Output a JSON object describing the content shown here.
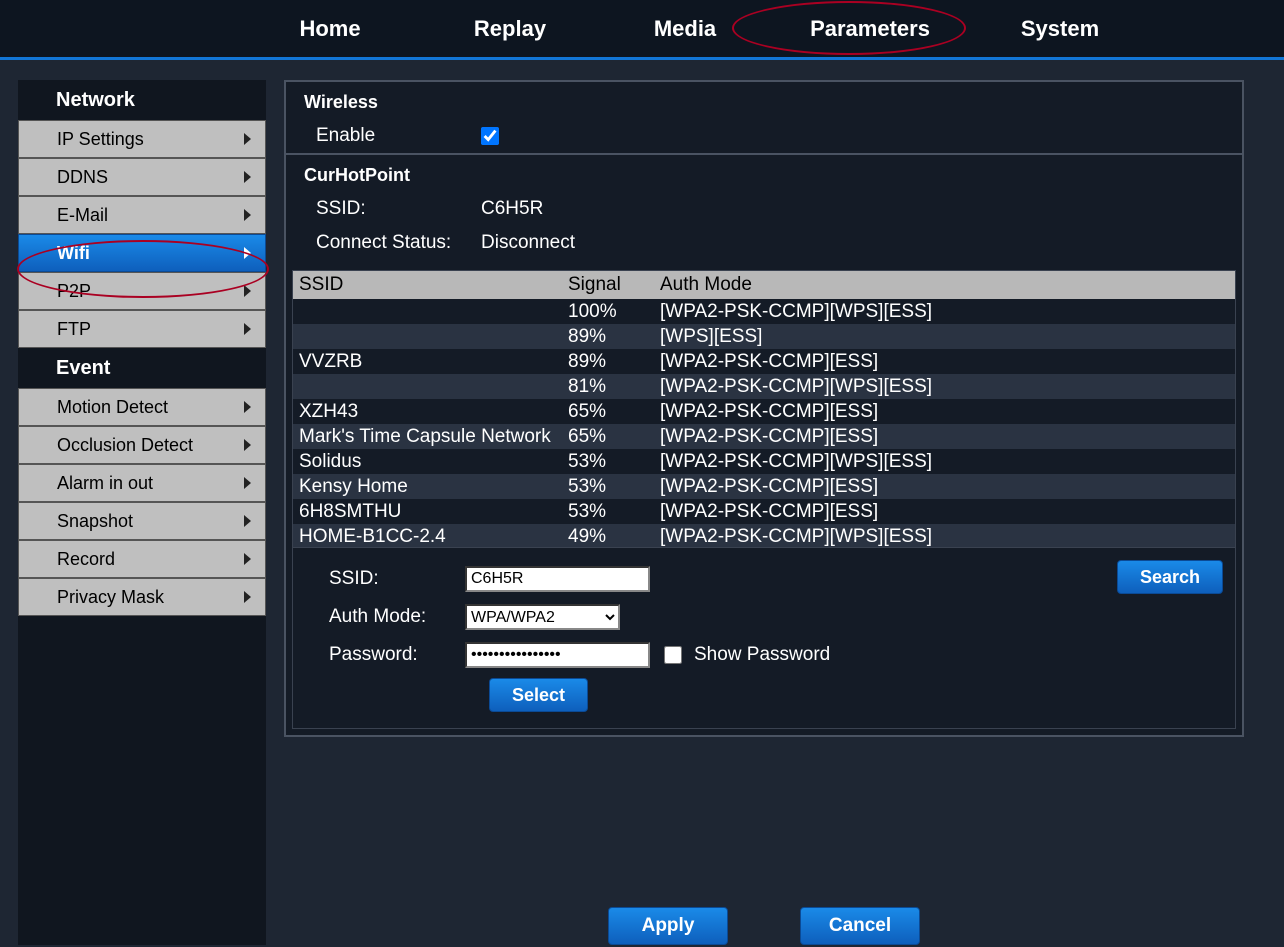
{
  "nav": {
    "home": "Home",
    "replay": "Replay",
    "media": "Media",
    "param": "Parameters",
    "system": "System"
  },
  "sidebar": {
    "network_title": "Network",
    "event_title": "Event",
    "network": [
      "IP Settings",
      "DDNS",
      "E-Mail",
      "Wifi",
      "P2P",
      "FTP"
    ],
    "event": [
      "Motion Detect",
      "Occlusion Detect",
      "Alarm in out",
      "Snapshot",
      "Record",
      "Privacy Mask"
    ]
  },
  "panel": {
    "wireless_head": "Wireless",
    "enable_label": "Enable",
    "cur_head": "CurHotPoint",
    "ssid_label": "SSID:",
    "ssid_value": "C6H5R",
    "conn_label": "Connect Status:",
    "conn_value": "Disconnect"
  },
  "grid": {
    "head_ssid": "SSID",
    "head_signal": "Signal",
    "head_auth": "Auth Mode",
    "rows": [
      {
        "ssid": "",
        "signal": "100%",
        "auth": "[WPA2-PSK-CCMP][WPS][ESS]"
      },
      {
        "ssid": "",
        "signal": "89%",
        "auth": "[WPS][ESS]"
      },
      {
        "ssid": "VVZRB",
        "signal": "89%",
        "auth": "[WPA2-PSK-CCMP][ESS]"
      },
      {
        "ssid": "",
        "signal": "81%",
        "auth": "[WPA2-PSK-CCMP][WPS][ESS]"
      },
      {
        "ssid": "XZH43",
        "signal": "65%",
        "auth": "[WPA2-PSK-CCMP][ESS]"
      },
      {
        "ssid": "Mark's Time Capsule Network",
        "signal": "65%",
        "auth": "[WPA2-PSK-CCMP][ESS]"
      },
      {
        "ssid": "Solidus",
        "signal": "53%",
        "auth": "[WPA2-PSK-CCMP][WPS][ESS]"
      },
      {
        "ssid": "Kensy Home",
        "signal": "53%",
        "auth": "[WPA2-PSK-CCMP][ESS]"
      },
      {
        "ssid": "6H8SMTHU",
        "signal": "53%",
        "auth": "[WPA2-PSK-CCMP][ESS]"
      },
      {
        "ssid": "HOME-B1CC-2.4",
        "signal": "49%",
        "auth": "[WPA2-PSK-CCMP][WPS][ESS]"
      }
    ]
  },
  "form": {
    "ssid_label": "SSID:",
    "ssid_value": "C6H5R",
    "auth_label": "Auth Mode:",
    "auth_value": "WPA/WPA2",
    "password_label": "Password:",
    "password_value": "••••••••••••••••",
    "show_password_label": "Show Password",
    "search_btn": "Search",
    "select_btn": "Select"
  },
  "bottom": {
    "apply": "Apply",
    "cancel": "Cancel"
  }
}
